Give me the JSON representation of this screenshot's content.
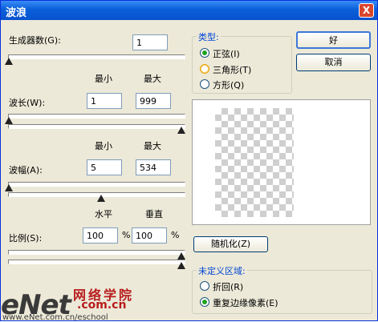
{
  "window": {
    "title": "波浪",
    "close_glyph": "X"
  },
  "generators": {
    "label": "生成器数",
    "key": "(G)",
    "colon": ":",
    "value": "1"
  },
  "wavelength": {
    "min_label": "最小",
    "max_label": "最大",
    "label": "波长",
    "key": "(W)",
    "colon": ":",
    "min": "1",
    "max": "999"
  },
  "amplitude": {
    "min_label": "最小",
    "max_label": "最大",
    "label": "波幅",
    "key": "(A)",
    "colon": ":",
    "min": "5",
    "max": "534"
  },
  "scale": {
    "h_label": "水平",
    "v_label": "垂直",
    "label": "比例",
    "key": "(S)",
    "colon": ":",
    "h": "100",
    "v": "100",
    "percent": "%"
  },
  "buttons": {
    "ok": "好",
    "cancel": "取消",
    "randomize": "随机化",
    "randomize_key": "(Z)"
  },
  "type_group": {
    "title": "类型:",
    "options": [
      {
        "label": "正弦",
        "key": "(I)",
        "selected": true
      },
      {
        "label": "三角形",
        "key": "(T)",
        "selected": false
      },
      {
        "label": "方形",
        "key": "(Q)",
        "selected": false
      }
    ]
  },
  "undefined_group": {
    "title": "未定义区域:",
    "options": [
      {
        "label": "折回",
        "key": "(R)",
        "selected": false
      },
      {
        "label": "重复边缘像素",
        "key": "(E)",
        "selected": true
      }
    ]
  },
  "watermark": {
    "logo": "eNet",
    "cn": "网络学院",
    "domain": ".com.cn",
    "url": "www.eNet.com.cn/eschool"
  }
}
